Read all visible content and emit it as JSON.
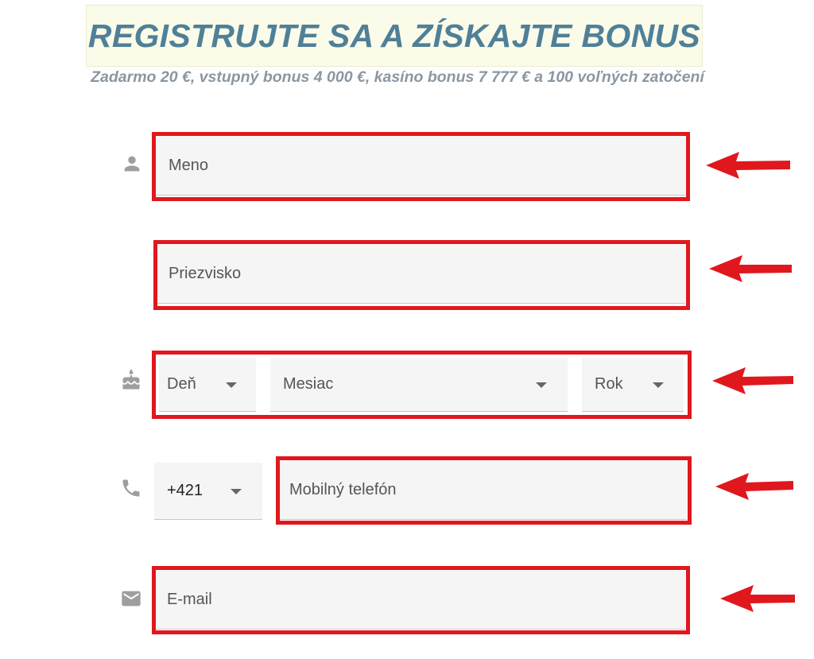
{
  "banner": {
    "title": "REGISTRUJTE SA A ZÍSKAJTE BONUS",
    "subtitle": "Zadarmo 20 €, vstupný bonus 4 000 €, kasíno bonus 7 777 € a 100 voľných zatočení"
  },
  "form": {
    "first_name": {
      "placeholder": "Meno"
    },
    "last_name": {
      "placeholder": "Priezvisko"
    },
    "birthdate": {
      "day_label": "Deň",
      "month_label": "Mesiac",
      "year_label": "Rok"
    },
    "phone": {
      "country_code": "+421",
      "placeholder": "Mobilný telefón"
    },
    "email": {
      "placeholder": "E-mail"
    }
  },
  "icons": [
    "person-icon",
    "cake-icon",
    "phone-icon",
    "mail-icon",
    "arrow-left-icon"
  ],
  "colors": {
    "title": "#4f8098",
    "subtitle": "#8a97a2",
    "highlight": "#e0181e",
    "field_bg": "#f5f5f5",
    "icon": "#9e9e9e"
  }
}
